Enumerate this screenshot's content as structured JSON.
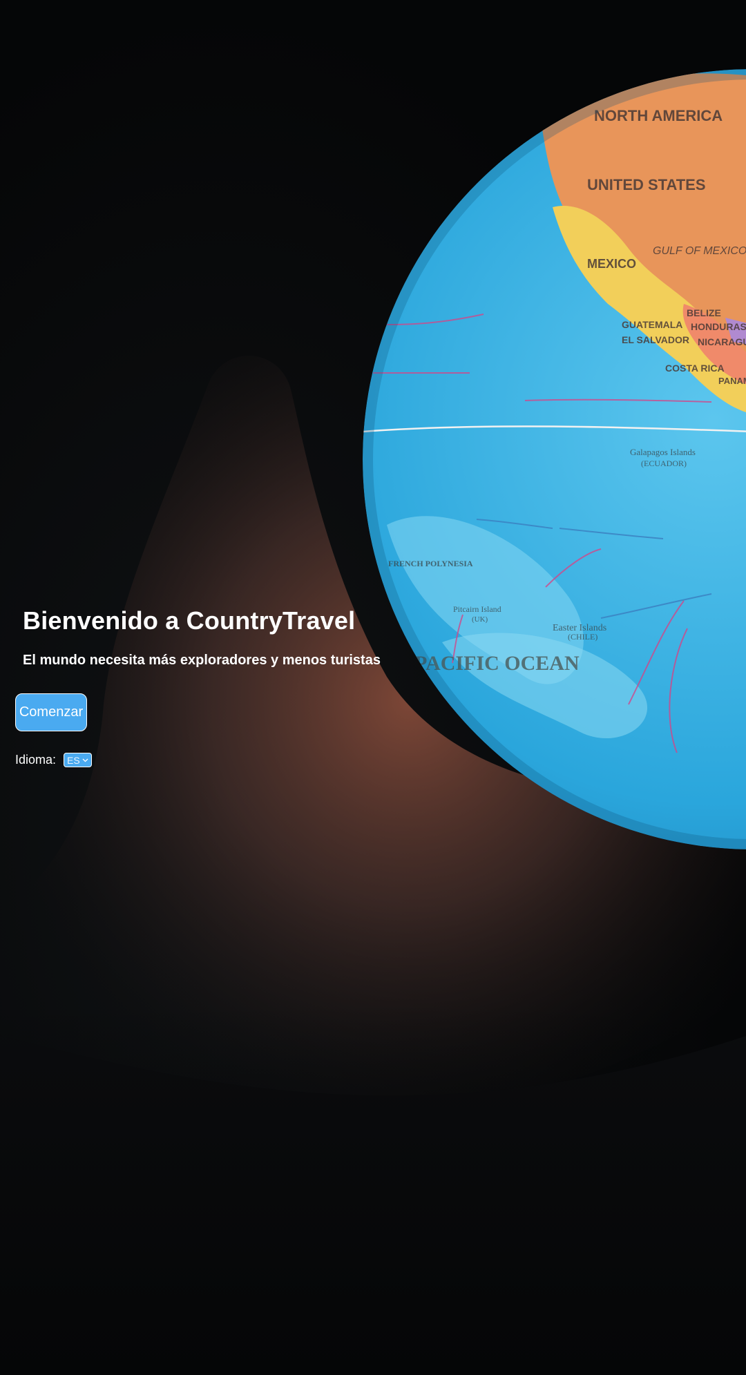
{
  "hero": {
    "title": "Bienvenido a CountryTravel",
    "subtitle": "El mundo necesita más exploradores y menos turistas"
  },
  "actions": {
    "start_label": "Comenzar"
  },
  "language": {
    "label": "Idioma:",
    "selected": "ES",
    "icon": "chevron-down-icon"
  },
  "globe_map_labels": [
    "NORTH AMERICA",
    "UNITED STATES",
    "GULF OF MEXICO",
    "MEXICO",
    "BELIZE",
    "GUATEMALA",
    "HONDURAS",
    "EL SALVADOR",
    "NICARAGUA",
    "COSTA RICA",
    "PANAMA",
    "Galapagos Islands",
    "(ECUADOR)",
    "FRENCH POLYNESIA",
    "Pitcairn Island",
    "(UK)",
    "Easter Islands",
    "(CHILE)",
    "PACIFIC OCEAN"
  ],
  "colors": {
    "background": "#050607",
    "accent": "#4aaaf0",
    "text": "#ffffff"
  }
}
